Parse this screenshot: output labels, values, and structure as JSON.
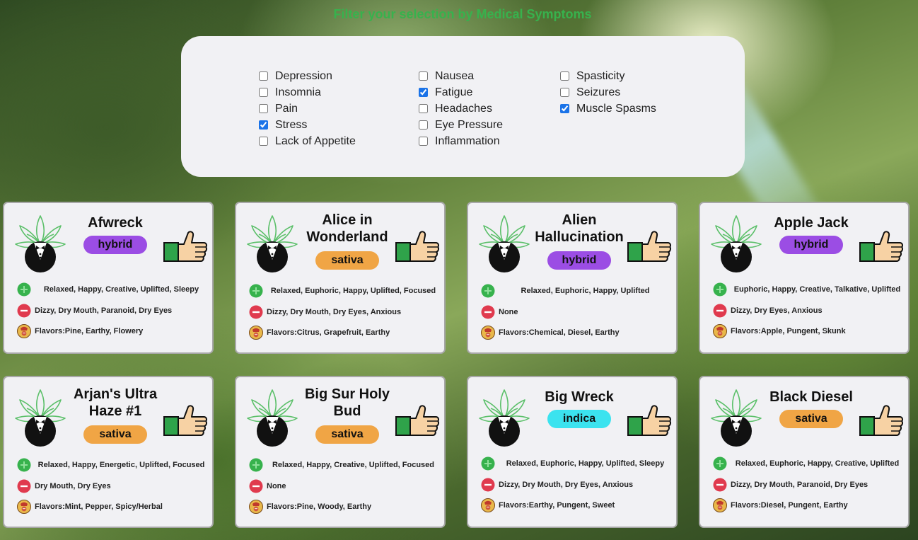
{
  "heading": "Filter your selection by Medical Symptoms",
  "filters": {
    "columns": [
      [
        {
          "label": "Depression",
          "checked": false
        },
        {
          "label": "Insomnia",
          "checked": false
        },
        {
          "label": "Pain",
          "checked": false
        },
        {
          "label": "Stress",
          "checked": true
        },
        {
          "label": "Lack of Appetite",
          "checked": false
        }
      ],
      [
        {
          "label": "Nausea",
          "checked": false
        },
        {
          "label": "Fatigue",
          "checked": true
        },
        {
          "label": "Headaches",
          "checked": false
        },
        {
          "label": "Eye Pressure",
          "checked": false
        },
        {
          "label": "Inflammation",
          "checked": false
        }
      ],
      [
        {
          "label": "Spasticity",
          "checked": false
        },
        {
          "label": "Seizures",
          "checked": false
        },
        {
          "label": "Muscle Spasms",
          "checked": true
        }
      ]
    ]
  },
  "colors": {
    "heading": "#37b24d",
    "hybrid": "#9b4de4",
    "sativa": "#f0a545",
    "indica": "#3be3ef",
    "positive": "#37b24d",
    "negative": "#e03a4e"
  },
  "icons": {
    "logo": "tuxedo-leaf-icon",
    "like": "thumbs-up-icon",
    "positive": "plus-circle-icon",
    "negative": "minus-circle-icon",
    "flavor": "flavor-icon"
  },
  "strains": [
    {
      "name": "Afwreck",
      "type": "hybrid",
      "positive": "Relaxed, Happy, Creative, Uplifted, Sleepy",
      "negative": "Dizzy, Dry Mouth, Paranoid, Dry Eyes",
      "flavors": "Flavors:Pine, Earthy, Flowery"
    },
    {
      "name": "Alice in Wonderland",
      "type": "sativa",
      "positive": "Relaxed, Euphoric, Happy, Uplifted, Focused",
      "negative": "Dizzy, Dry Mouth, Dry Eyes, Anxious",
      "flavors": "Flavors:Citrus, Grapefruit, Earthy"
    },
    {
      "name": "Alien Hallucination",
      "type": "hybrid",
      "positive": "Relaxed, Euphoric, Happy, Uplifted",
      "negative": "None",
      "flavors": "Flavors:Chemical, Diesel, Earthy"
    },
    {
      "name": "Apple Jack",
      "type": "hybrid",
      "positive": "Euphoric, Happy, Creative, Talkative, Uplifted",
      "negative": "Dizzy, Dry Eyes, Anxious",
      "flavors": "Flavors:Apple, Pungent, Skunk"
    },
    {
      "name": "Arjan's Ultra Haze #1",
      "type": "sativa",
      "positive": "Relaxed, Happy, Energetic, Uplifted, Focused",
      "negative": "Dry Mouth, Dry Eyes",
      "flavors": "Flavors:Mint, Pepper, Spicy/Herbal"
    },
    {
      "name": "Big Sur Holy Bud",
      "type": "sativa",
      "positive": "Relaxed, Happy, Creative, Uplifted, Focused",
      "negative": "None",
      "flavors": "Flavors:Pine, Woody, Earthy"
    },
    {
      "name": "Big Wreck",
      "type": "indica",
      "positive": "Relaxed, Euphoric, Happy, Uplifted, Sleepy",
      "negative": "Dizzy, Dry Mouth, Dry Eyes, Anxious",
      "flavors": "Flavors:Earthy, Pungent, Sweet"
    },
    {
      "name": "Black Diesel",
      "type": "sativa",
      "positive": "Relaxed, Euphoric, Happy, Creative, Uplifted",
      "negative": "Dizzy, Dry Mouth, Paranoid, Dry Eyes",
      "flavors": "Flavors:Diesel, Pungent, Earthy"
    }
  ]
}
